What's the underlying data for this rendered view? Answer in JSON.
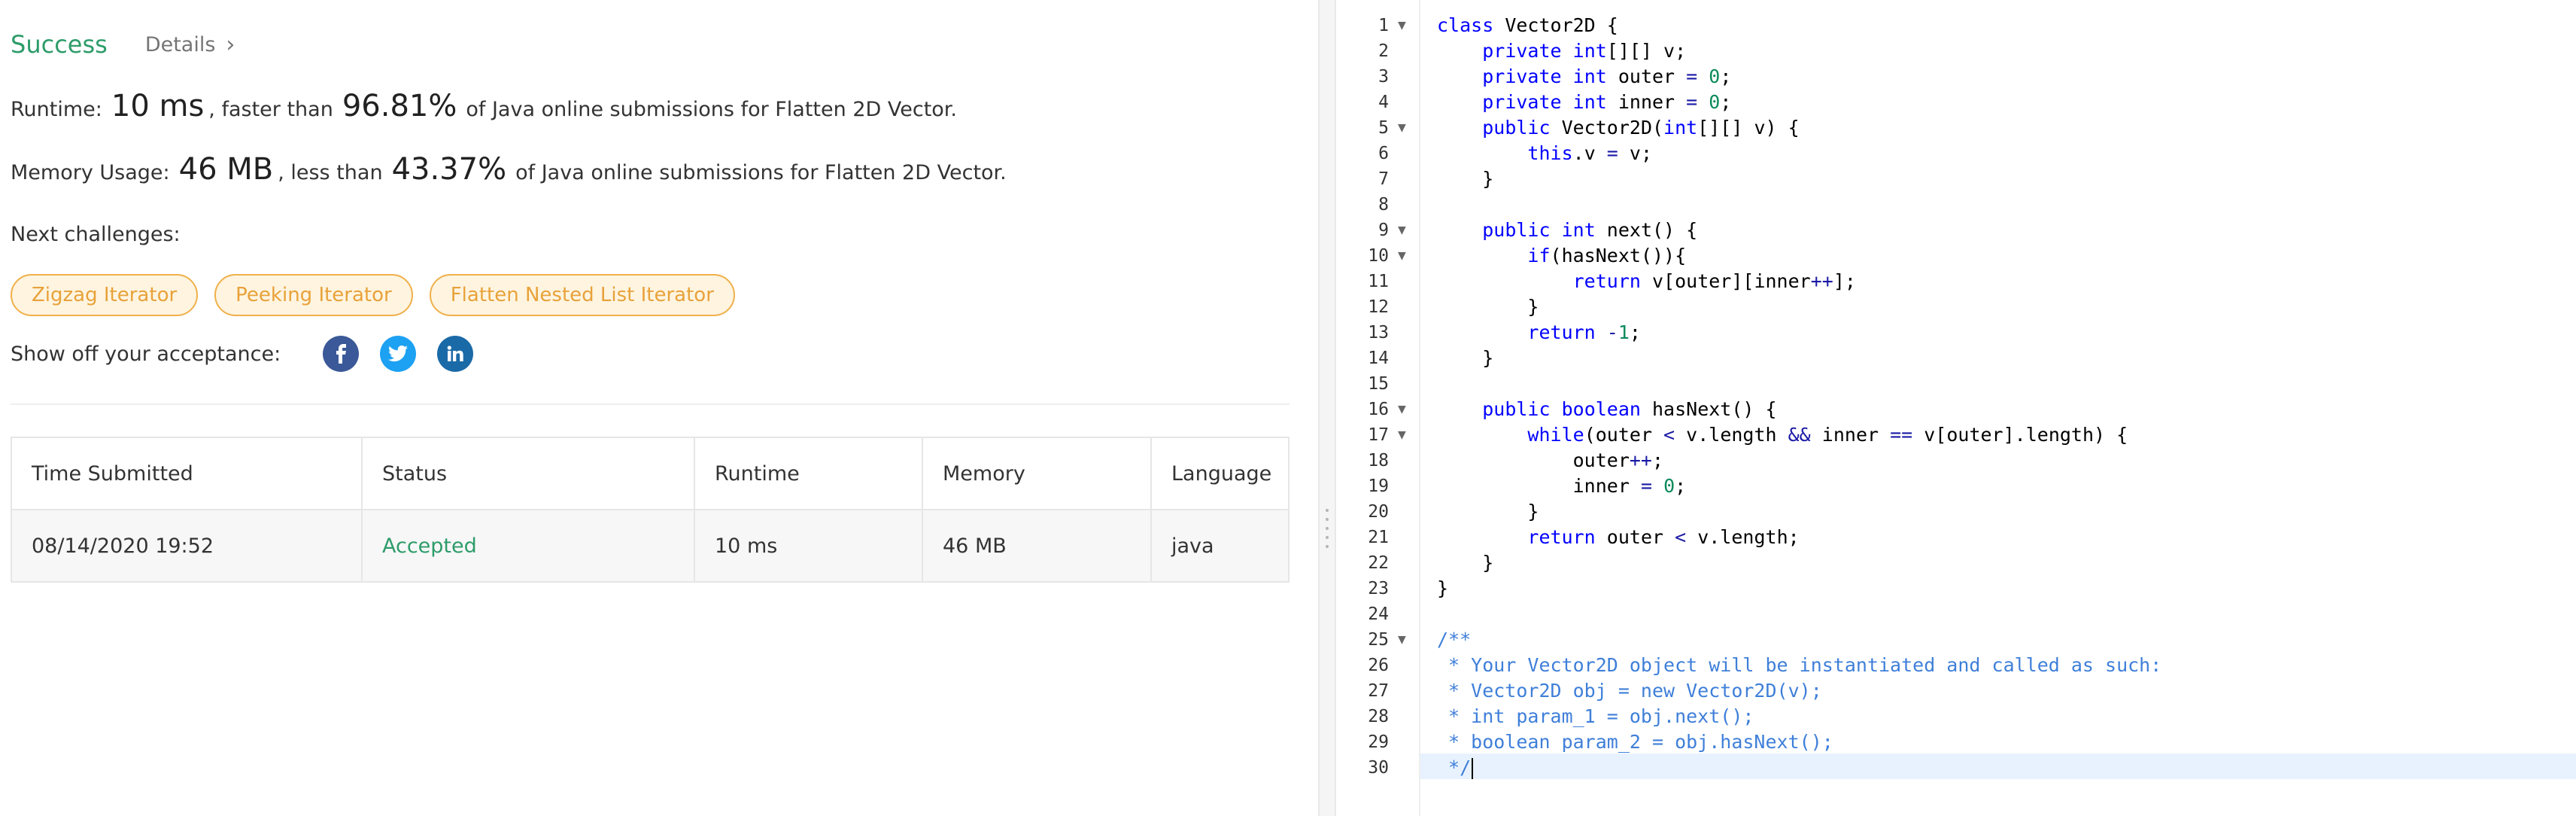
{
  "result": {
    "status": "Success",
    "details_label": "Details",
    "runtime": {
      "label": "Runtime:",
      "value": "10 ms",
      "middle": ", faster than",
      "percent": "96.81%",
      "suffix": "of Java online submissions for Flatten 2D Vector."
    },
    "memory": {
      "label": "Memory Usage:",
      "value": "46 MB",
      "middle": ", less than",
      "percent": "43.37%",
      "suffix": "of Java online submissions for Flatten 2D Vector."
    },
    "next_label": "Next challenges:",
    "challenges": [
      "Zigzag Iterator",
      "Peeking Iterator",
      "Flatten Nested List Iterator"
    ],
    "share_label": "Show off your acceptance:",
    "share_icons": [
      "facebook-icon",
      "twitter-icon",
      "linkedin-icon"
    ],
    "colors": {
      "success": "#2e9c6a",
      "chip_border": "#f0b04a",
      "chip_text": "#e8a23a",
      "facebook": "#3b5998",
      "twitter": "#1da1f2",
      "linkedin": "#1b6aa8"
    }
  },
  "table": {
    "headers": [
      "Time Submitted",
      "Status",
      "Runtime",
      "Memory",
      "Language"
    ],
    "rows": [
      [
        "08/14/2020 19:52",
        "Accepted",
        "10 ms",
        "46 MB",
        "java"
      ]
    ]
  },
  "editor": {
    "language": "java",
    "line_numbers": [
      "1",
      "2",
      "3",
      "4",
      "5",
      "6",
      "7",
      "8",
      "9",
      "10",
      "11",
      "12",
      "13",
      "14",
      "15",
      "16",
      "17",
      "18",
      "19",
      "20",
      "21",
      "22",
      "23",
      "24",
      "25",
      "26",
      "27",
      "28",
      "29",
      "30"
    ],
    "foldable_lines": [
      1,
      5,
      9,
      10,
      16,
      17,
      25
    ],
    "active_line": 30,
    "lines": [
      "class Vector2D {",
      "    private int[][] v;",
      "    private int outer = 0;",
      "    private int inner = 0;",
      "    public Vector2D(int[][] v) {",
      "        this.v = v;",
      "    }",
      "",
      "    public int next() {",
      "        if(hasNext()){",
      "            return v[outer][inner++];",
      "        }",
      "        return -1;",
      "    }",
      "",
      "    public boolean hasNext() {",
      "        while(outer < v.length && inner == v[outer].length) {",
      "            outer++;",
      "            inner = 0;",
      "        }",
      "        return outer < v.length;",
      "    }",
      "}",
      "",
      "/**",
      " * Your Vector2D object will be instantiated and called as such:",
      " * Vector2D obj = new Vector2D(v);",
      " * int param_1 = obj.next();",
      " * boolean param_2 = obj.hasNext();",
      " */"
    ]
  }
}
